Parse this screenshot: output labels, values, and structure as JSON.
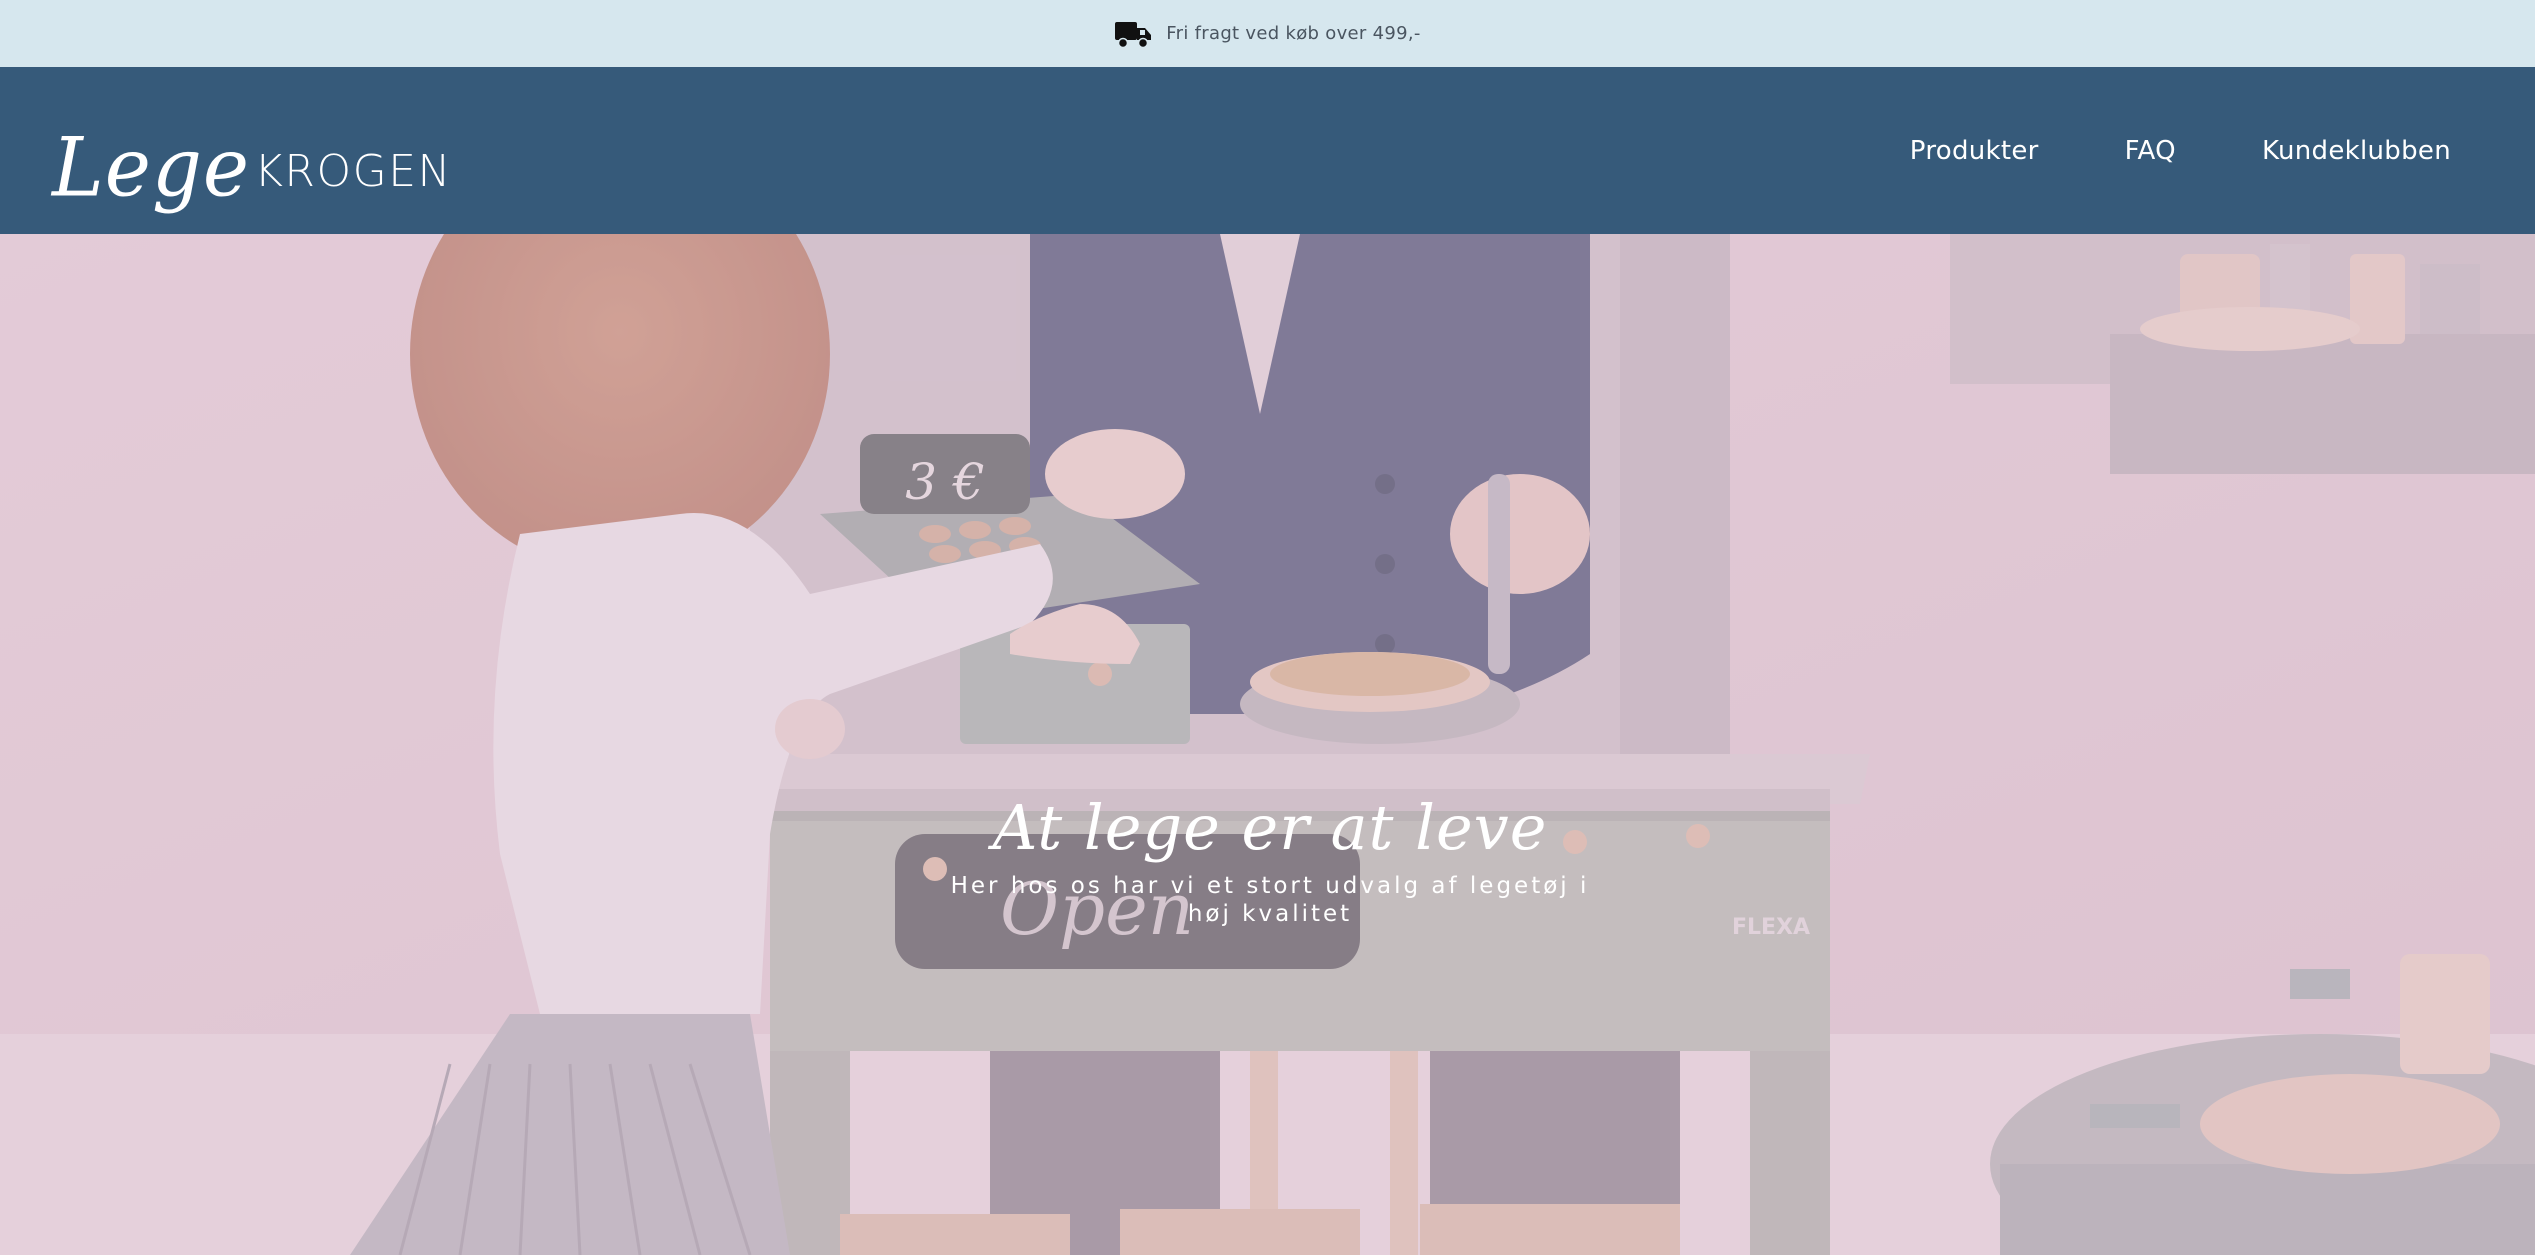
{
  "announcement": {
    "icon": "truck-icon",
    "text": "Fri fragt ved køb over 499,-"
  },
  "header": {
    "logo": {
      "script": "Lege",
      "caps": "KROGEN"
    },
    "nav": [
      "Produkter",
      "FAQ",
      "Kundeklubben"
    ]
  },
  "hero": {
    "title": "At lege er at leve",
    "subtitle": "Her hos os har vi et stort udvalg af legetøj i høj kvalitet",
    "photo_text": {
      "register_price": "3 €",
      "sign": "Open",
      "brand": "FLEXA"
    }
  },
  "colors": {
    "announcement_bg": "#d6e7ee",
    "header_bg": "#365a7a",
    "hero_tint": "#e0c4d4"
  }
}
